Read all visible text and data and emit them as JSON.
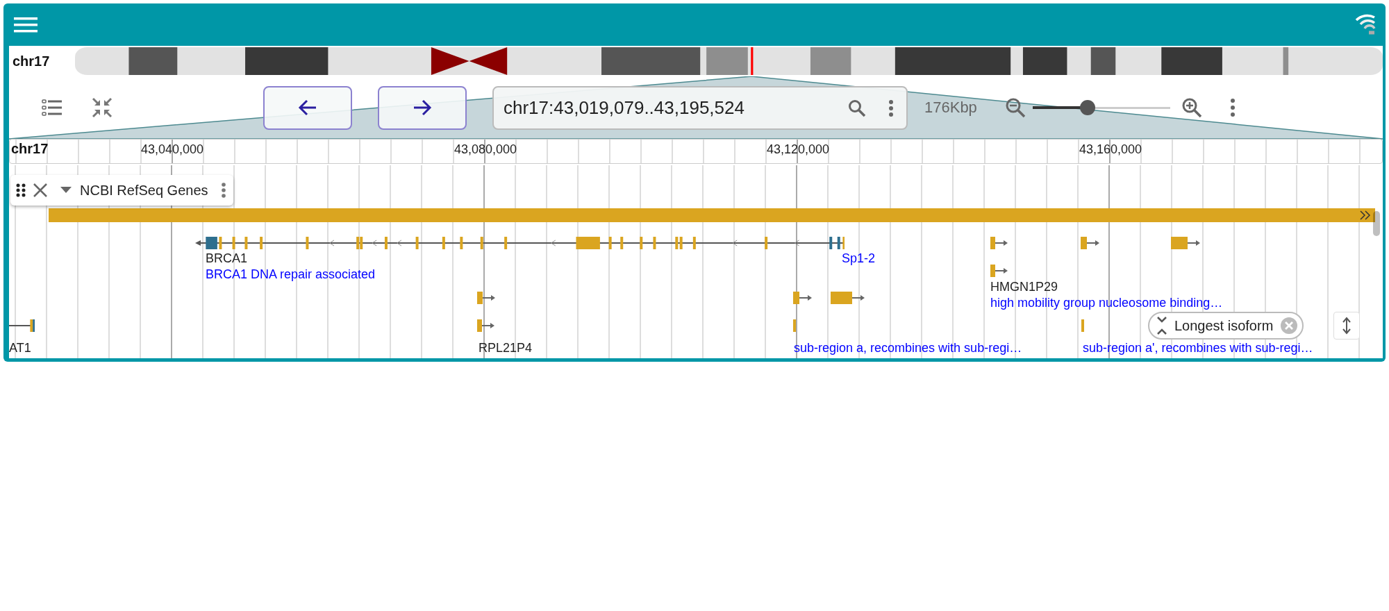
{
  "ideogram": {
    "chromosome": "chr17"
  },
  "toolbar": {
    "location": "chr17:43,019,079..43,195,524",
    "span": "176Kbp",
    "zoom": {
      "level": 0.4
    }
  },
  "ruler": {
    "chromosome": "chr17",
    "ticks": [
      "43,040,000",
      "43,080,000",
      "43,120,000",
      "43,160,000"
    ]
  },
  "track": {
    "title": "NCBI RefSeq Genes",
    "features": [
      {
        "name": "BRCA1",
        "description": "BRCA1 DNA repair associated"
      },
      {
        "description": "Sp1-2"
      },
      {
        "name": "HMGN1P29",
        "description": "high mobility group nucleosome binding…"
      },
      {
        "name": "AT1"
      },
      {
        "name": "RPL21P4"
      },
      {
        "description": "sub-region a, recombines with sub-regi…"
      },
      {
        "description": "sub-region a', recombines with sub-regi…"
      }
    ]
  },
  "filter_chip": {
    "label": "Longest isoform"
  }
}
